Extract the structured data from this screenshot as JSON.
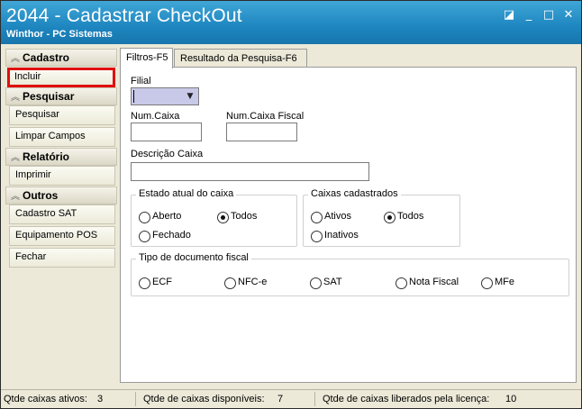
{
  "window": {
    "title": "2044 - Cadastrar CheckOut",
    "subtitle": "Winthor - PC Sistemas",
    "controls": {
      "restore": "◪",
      "minimize": "_",
      "maximize": "□",
      "close": "✕"
    }
  },
  "sidebar": {
    "groups": [
      {
        "label": "Cadastro",
        "items": [
          "Incluir"
        ]
      },
      {
        "label": "Pesquisar",
        "items": [
          "Pesquisar",
          "Limpar Campos"
        ]
      },
      {
        "label": "Relatório",
        "items": [
          "Imprimir"
        ]
      },
      {
        "label": "Outros",
        "items": [
          "Cadastro SAT",
          "Equipamento POS",
          "Fechar"
        ]
      }
    ]
  },
  "tabs": [
    {
      "label": "Filtros-F5",
      "active": true
    },
    {
      "label": "Resultado da Pesquisa-F6",
      "active": false
    }
  ],
  "filters": {
    "filial_label": "Filial",
    "filial_value": "",
    "num_caixa_label": "Num.Caixa",
    "num_caixa_value": "",
    "num_caixa_fiscal_label": "Num.Caixa Fiscal",
    "num_caixa_fiscal_value": "",
    "descricao_label": "Descrição Caixa",
    "descricao_value": "",
    "estado": {
      "title": "Estado atual do caixa",
      "options": [
        "Aberto",
        "Todos",
        "Fechado"
      ],
      "selected": "Todos"
    },
    "cadastrados": {
      "title": "Caixas cadastrados",
      "options": [
        "Ativos",
        "Todos",
        "Inativos"
      ],
      "selected": "Todos"
    },
    "tipo_doc": {
      "title": "Tipo de documento fiscal",
      "options": [
        "ECF",
        "NFC-e",
        "SAT",
        "Nota Fiscal",
        "MFe"
      ],
      "selected": ""
    }
  },
  "status": {
    "ativos_label": "Qtde caixas ativos:",
    "ativos_value": "3",
    "disponiveis_label": "Qtde de caixas disponíveis:",
    "disponiveis_value": "7",
    "liberados_label": "Qtde de caixas liberados pela licença:",
    "liberados_value": "10"
  },
  "colors": {
    "title_bar": "#1e86c0",
    "highlight": "#e01010",
    "combo_selected": "#c8c8e8"
  }
}
